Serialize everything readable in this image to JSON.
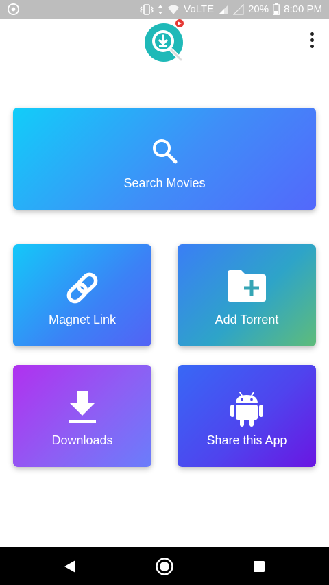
{
  "status_bar": {
    "battery": "20%",
    "time": "8:00 PM",
    "network": "VoLTE",
    "icons": [
      "app-notification-icon",
      "vibrate-icon",
      "wifi-icon",
      "signal-icon",
      "battery-icon"
    ]
  },
  "header": {
    "logo_icon": "download-search-logo-icon",
    "menu_icon": "overflow-menu-icon"
  },
  "cards": {
    "search": {
      "label": "Search Movies",
      "icon": "search-icon"
    },
    "magnet": {
      "label": "Magnet Link",
      "icon": "link-icon"
    },
    "torrent": {
      "label": "Add Torrent",
      "icon": "folder-add-icon"
    },
    "downloads": {
      "label": "Downloads",
      "icon": "download-icon"
    },
    "share": {
      "label": "Share this App",
      "icon": "android-icon"
    }
  },
  "nav_bar": {
    "back_icon": "back-icon",
    "home_icon": "home-icon",
    "recent_icon": "recent-apps-icon"
  },
  "colors": {
    "status_bar": "#bdbdbd",
    "logo_teal": "#1fb9b8",
    "badge_red": "#e53935",
    "nav_bar": "#000000"
  }
}
